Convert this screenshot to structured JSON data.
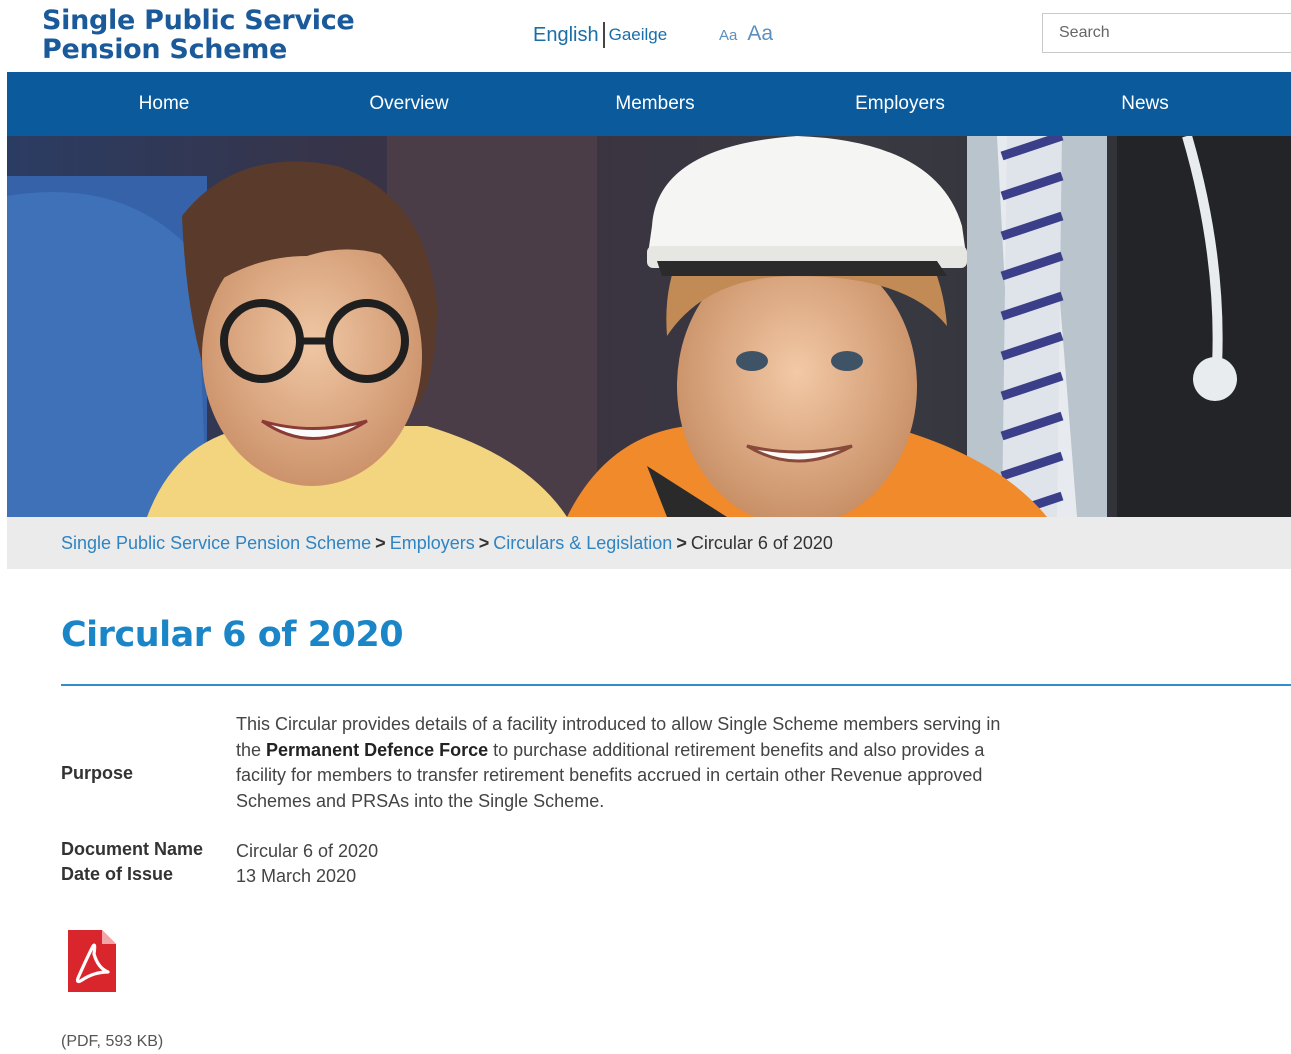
{
  "header": {
    "logo_line1": "Single Public Service",
    "logo_line2": "Pension Scheme",
    "lang_english": "English",
    "lang_irish": "Gaeilge",
    "font_small": "Aa",
    "font_large": "Aa",
    "search_placeholder": "Search"
  },
  "nav": {
    "items": [
      {
        "label": "Home"
      },
      {
        "label": "Overview"
      },
      {
        "label": "Members"
      },
      {
        "label": "Employers"
      },
      {
        "label": "News"
      }
    ]
  },
  "breadcrumb": {
    "items": [
      {
        "label": "Single Public Service Pension Scheme"
      },
      {
        "label": "Employers"
      },
      {
        "label": "Circulars & Legislation"
      }
    ],
    "separator": ">",
    "current": "Circular 6 of 2020"
  },
  "page": {
    "title": "Circular 6 of 2020",
    "purpose_label": "Purpose",
    "purpose_text_before": "This Circular provides details of a facility introduced to allow Single Scheme members serving in the ",
    "purpose_text_bold": "Permanent Defence Force",
    "purpose_text_after": " to purchase additional retirement benefits and also provides a facility for members to transfer retirement benefits accrued in certain other Revenue approved Schemes and PRSAs into the Single Scheme.",
    "docname_label": "Document Name",
    "docname_value": "Circular 6 of 2020",
    "date_label": "Date of Issue",
    "date_value": "13 March 2020",
    "pdf_icon": "pdf-file-icon",
    "pdf_meta": "(PDF, 593 KB)"
  },
  "colors": {
    "brand_blue": "#0a5a9c",
    "title_blue": "#1b86c7",
    "link_blue": "#2f84c2"
  }
}
